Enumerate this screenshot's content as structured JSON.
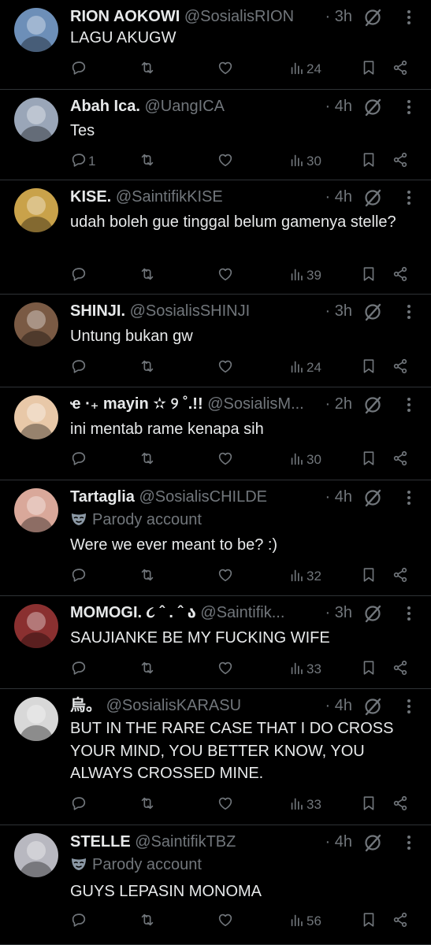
{
  "tweets": [
    {
      "name": "RION AOKOWI",
      "handle": "@SosialisRION",
      "time": "· 3h",
      "parody": "",
      "text": "LAGU AKUGW",
      "replies": "",
      "views": "24",
      "avatar": "#6d8fb8"
    },
    {
      "name": "Abah Ica.",
      "handle": "@UangICA",
      "time": "· 4h",
      "parody": "",
      "text": "Tes",
      "replies": "1",
      "views": "30",
      "avatar": "#9aa6b8"
    },
    {
      "name": "KISE.",
      "handle": "@SaintifikKISE",
      "time": "· 4h",
      "parody": "",
      "text": "udah boleh gue tinggal belum gamenya stelle?",
      "replies": "",
      "views": "39",
      "avatar": "#c9a24a"
    },
    {
      "name": "SHINJI.",
      "handle": "@SosialisSHINJI",
      "time": "· 3h",
      "parody": "",
      "text": "Untung bukan gw",
      "replies": "",
      "views": "24",
      "avatar": "#7a5a44"
    },
    {
      "name": "ҽ ·₊ mayin ✫ ୨ ˚.!!",
      "handle": "@SosialisM...",
      "time": "· 2h",
      "parody": "",
      "text": "ini mentab rame kenapa sih",
      "replies": "",
      "views": "30",
      "avatar": "#e8c8a8"
    },
    {
      "name": "Tartaglia",
      "handle": "@SosialisCHILDE",
      "time": "· 4h",
      "parody": "Parody account",
      "text": "Were we ever meant to be? :)",
      "replies": "",
      "views": "32",
      "avatar": "#d9a89a"
    },
    {
      "name": "MOMOGI. ૮ ˆ . ˆ ა",
      "handle": "@Saintifik...",
      "time": "· 3h",
      "parody": "",
      "text": "SAUJIANKE BE MY FUCKING WIFE",
      "replies": "",
      "views": "33",
      "avatar": "#8a3030"
    },
    {
      "name": "烏。",
      "handle": "@SosialisKARASU",
      "time": "· 4h",
      "parody": "",
      "text": "BUT IN THE RARE CASE THAT I DO CROSS YOUR MIND, YOU BETTER KNOW, YOU ALWAYS CROSSED MINE.",
      "replies": "",
      "views": "33",
      "avatar": "#d8d8d8"
    },
    {
      "name": "STELLE",
      "handle": "@SaintifikTBZ",
      "time": "· 4h",
      "parody": "Parody account",
      "text": "GUYS LEPASIN MONOMA",
      "replies": "",
      "views": "56",
      "avatar": "#b8b8c0"
    }
  ],
  "icons": {
    "reply": "reply-icon",
    "retweet": "retweet-icon",
    "like": "heart-icon",
    "views": "views-icon",
    "bookmark": "bookmark-icon",
    "share": "share-icon",
    "grok": "grok-icon",
    "more": "more-icon",
    "parody": "mask-icon"
  },
  "colors": {
    "background": "#000000",
    "text": "#e7e9ea",
    "muted": "#71767b",
    "divider": "#2f3336"
  }
}
